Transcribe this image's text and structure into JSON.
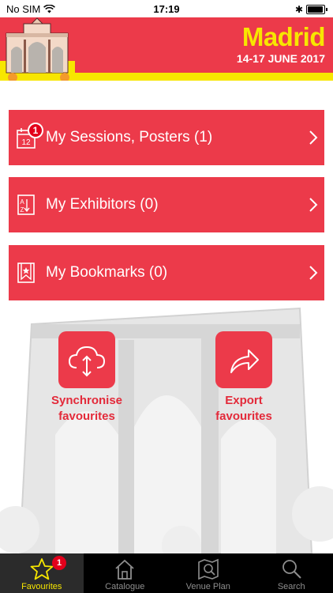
{
  "status_bar": {
    "carrier": "No SIM",
    "time": "17:19",
    "battery_level": 0.95
  },
  "header": {
    "city": "Madrid",
    "dates": "14-17 JUNE 2017"
  },
  "menu": [
    {
      "label": "My Sessions, Posters (1)",
      "icon": "calendar-icon",
      "badge": "1"
    },
    {
      "label": "My Exhibitors (0)",
      "icon": "exhibitor-list-icon"
    },
    {
      "label": "My Bookmarks (0)",
      "icon": "bookmark-icon"
    }
  ],
  "actions": {
    "sync": {
      "line1": "Synchronise",
      "line2": "favourites",
      "icon": "cloud-sync-icon"
    },
    "export": {
      "line1": "Export",
      "line2": "favourites",
      "icon": "share-arrow-icon"
    }
  },
  "tabs": [
    {
      "label": "Favourites",
      "icon": "star-icon",
      "active": true,
      "badge": "1"
    },
    {
      "label": "Catalogue",
      "icon": "home-icon",
      "active": false
    },
    {
      "label": "Venue Plan",
      "icon": "map-search-icon",
      "active": false
    },
    {
      "label": "Search",
      "icon": "search-icon",
      "active": false
    }
  ],
  "colors": {
    "brand_red": "#ec3a4a",
    "brand_yellow": "#f7e600",
    "tabbar": "#000000"
  }
}
